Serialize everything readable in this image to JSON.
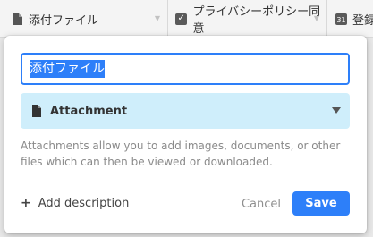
{
  "header": {
    "fields": [
      {
        "label": "添付ファイル",
        "icon": "file-icon"
      },
      {
        "label": "プライバシーポリシー同意",
        "icon": "checkbox-icon"
      },
      {
        "label": "登録",
        "icon": "number-icon"
      }
    ]
  },
  "popup": {
    "name_value": "添付ファイル",
    "type_label": "Attachment",
    "description": "Attachments allow you to add images, documents, or other files which can then be viewed or downloaded.",
    "add_description_label": "Add description",
    "cancel_label": "Cancel",
    "save_label": "Save"
  },
  "colors": {
    "accent": "#2d7ff9",
    "type_bg": "#cfeefb"
  }
}
